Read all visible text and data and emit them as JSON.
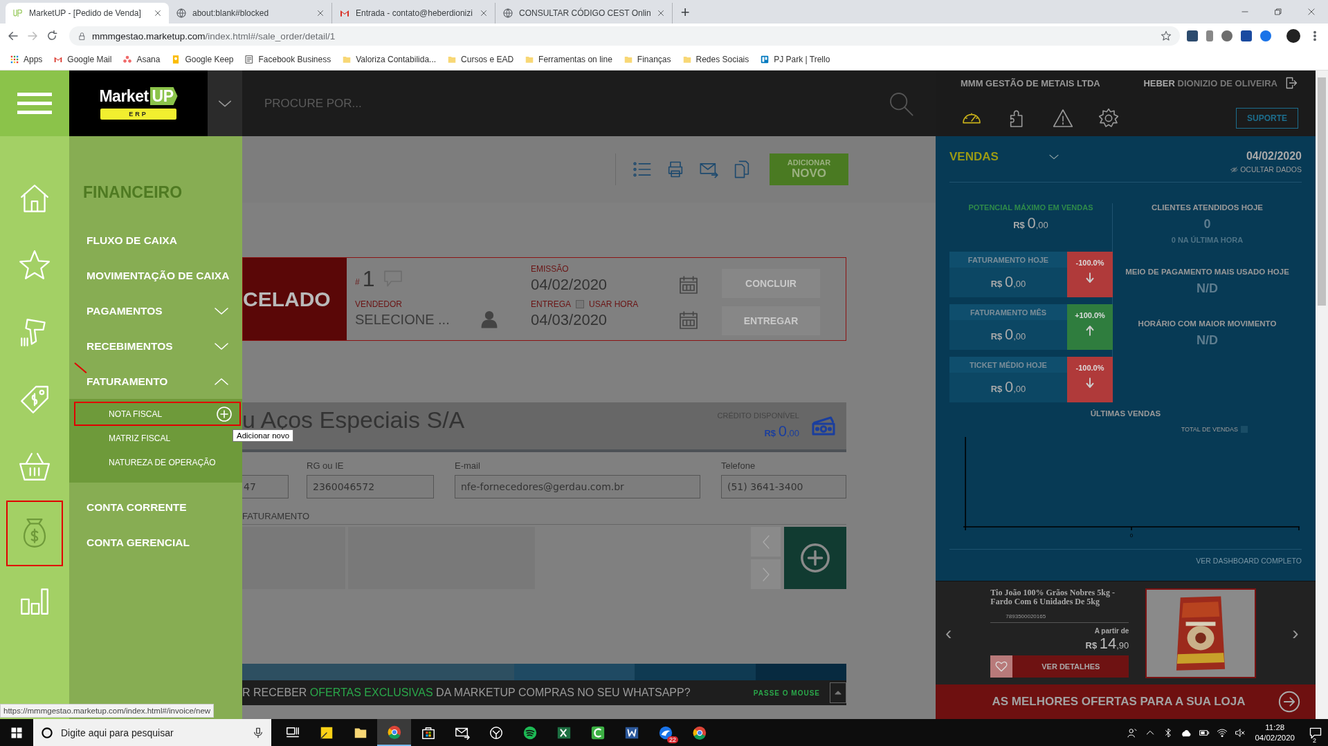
{
  "browser": {
    "tabs": [
      {
        "title": "MarketUP - [Pedido de Venda]",
        "selected": true
      },
      {
        "title": "about:blank#blocked",
        "selected": false
      },
      {
        "title": "Entrada - contato@heberdionizi",
        "selected": false
      },
      {
        "title": "CONSULTAR CÓDIGO CEST Onlin",
        "selected": false
      }
    ],
    "new_tab": "+",
    "address_host": "mmmgestao.marketup.com",
    "address_path": "/index.html#/sale_order/detail/1",
    "bookmarks": [
      "Apps",
      "Google Mail",
      "Asana",
      "Google Keep",
      "Facebook Business",
      "Valoriza Contabilida...",
      "Cursos e EAD",
      "Ferramentas on line",
      "Finanças",
      "Redes Sociais",
      "PJ Park | Trello"
    ],
    "status_url": "https://mmmgestao.marketup.com/index.html#/invoice/new"
  },
  "app": {
    "logo": "Market",
    "logo_accent": "UP",
    "logo_tag": "ERP",
    "search": {
      "placeholder": "PROCURE POR..."
    },
    "company": "MMM GESTÃO DE METAIS LTDA",
    "user_first": "HEBER",
    "user_rest": "DIONIZIO DE OLIVEIRA",
    "support": "SUPORTE",
    "header_icons": [
      {
        "kind": "gauge"
      },
      {
        "kind": "puzzle"
      },
      {
        "kind": "warning"
      },
      {
        "kind": "gear"
      }
    ]
  },
  "sidebar_icons": [
    {
      "kind": "home",
      "selected": false
    },
    {
      "kind": "star",
      "selected": false
    },
    {
      "kind": "scanner",
      "selected": false
    },
    {
      "kind": "tag",
      "selected": false
    },
    {
      "kind": "basket",
      "selected": false
    },
    {
      "kind": "money",
      "selected": true
    },
    {
      "kind": "bars",
      "selected": false
    }
  ],
  "menu": {
    "title": "FINANCEIRO",
    "items": [
      {
        "label": "FLUXO DE CAIXA",
        "expandable": false,
        "marked": false
      },
      {
        "label": "MOVIMENTAÇÃO DE CAIXA",
        "expandable": false,
        "marked": false
      },
      {
        "label": "PAGAMENTOS",
        "expandable": true,
        "expanded": false,
        "marked": false
      },
      {
        "label": "RECEBIMENTOS",
        "expandable": true,
        "expanded": false,
        "marked": false
      },
      {
        "label": "FATURAMENTO",
        "expandable": true,
        "expanded": true,
        "marked": true,
        "children": [
          {
            "label": "NOTA FISCAL",
            "highlighted": true,
            "tooltip": "Adicionar novo"
          },
          {
            "label": "MATRIZ FISCAL",
            "highlighted": false
          },
          {
            "label": "NATUREZA DE OPERAÇÃO",
            "highlighted": false
          }
        ]
      },
      {
        "label": "CONTA CORRENTE",
        "expandable": false,
        "marked": false
      },
      {
        "label": "CONTA GERENCIAL",
        "expandable": false,
        "marked": false
      }
    ]
  },
  "main": {
    "toolbar": [
      {
        "kind": "list"
      },
      {
        "kind": "print"
      },
      {
        "kind": "mail"
      },
      {
        "kind": "copy"
      }
    ],
    "add_button": {
      "top": "ADICIONAR",
      "bottom": "NOVO"
    },
    "order": {
      "status": "CELADO",
      "number_prefix": "#",
      "number": "1",
      "vendor_label": "VENDEDOR",
      "vendor": "SELECIONE ...",
      "issue_label": "EMISSÃO",
      "issue_date": "04/02/2020",
      "delivery_label": "ENTREGA",
      "use_time": {
        "label": "USAR HORA",
        "checked": false
      },
      "delivery_date": "04/03/2020",
      "actions": [
        {
          "label": "CONCLUIR",
          "disabled": true
        },
        {
          "label": "ENTREGAR",
          "disabled": true
        }
      ]
    },
    "customer": {
      "name": "u Aços Especiais S/A",
      "credit_label": "CRÉDITO DISPONÍVEL",
      "credit_currency": "R$",
      "credit_int": "0",
      "credit_dec": ",00"
    },
    "fields": [
      {
        "value": "47"
      },
      {
        "label": "RG ou IE",
        "value": "2360046572"
      },
      {
        "label": "E-mail",
        "value": "nfe-fornecedores@gerdau.com.br"
      },
      {
        "label": "Telefone",
        "value": "(51) 3641-3400"
      }
    ],
    "billing_label": "FATURAMENTO",
    "whatsapp": {
      "parts": [
        {
          "text": "R RECEBER ",
          "accent": false
        },
        {
          "text": "OFERTAS EXCLUSIVAS",
          "accent": true
        },
        {
          "text": " DA MARKETUP COMPRAS NO SEU WHATSAPP?",
          "accent": false
        }
      ],
      "hint": "PASSE O MOUSE"
    }
  },
  "dashboard": {
    "title": "VENDAS",
    "date": "04/02/2020",
    "hide": "OCULTAR DADOS",
    "potential_label": "POTENCIAL MÁXIMO EM VENDAS",
    "potential_currency": "R$",
    "potential_int": "0",
    "potential_dec": ",00",
    "metrics": [
      {
        "label": "FATURAMENTO HOJE",
        "currency": "R$",
        "int": "0",
        "dec": ",00",
        "change": "-100.0%",
        "rising": false
      },
      {
        "label": "FATURAMENTO MÊS",
        "currency": "R$",
        "int": "0",
        "dec": ",00",
        "change": "+100.0%",
        "rising": true
      },
      {
        "label": "TICKET MÉDIO HOJE",
        "currency": "R$",
        "int": "0",
        "dec": ",00",
        "change": "-100.0%",
        "rising": false
      }
    ],
    "stats": [
      {
        "label": "CLIENTES ATENDIDOS HOJE",
        "value": "0",
        "note": "0 NA ÚLTIMA HORA"
      },
      {
        "label": "MEIO DE PAGAMENTO MAIS USADO HOJE",
        "value": "N/D"
      },
      {
        "label": "HORÁRIO COM MAIOR MOVIMENTO",
        "value": "N/D"
      }
    ],
    "chart_title": "ÚLTIMAS VENDAS",
    "chart_legend": "TOTAL DE VENDAS",
    "chart_tick": "0",
    "dashboard_link": "VER DASHBOARD COMPLETO"
  },
  "offer": {
    "product": "Tio João 100% Grãos Nobres 5kg - Fardo Com 6 Unidades De 5kg",
    "code": "7893500020165",
    "from": "A partir de",
    "currency": "R$",
    "int": "14",
    "dec": ",90",
    "details": "VER DETALHES",
    "prev": "‹",
    "next": "›",
    "banner": "AS MELHORES OFERTAS PARA A SUA LOJA"
  },
  "taskbar": {
    "search_placeholder": "Digite aqui para pesquisar",
    "apps": [
      {
        "kind": "taskview",
        "active": false
      },
      {
        "kind": "notes",
        "active": false
      },
      {
        "kind": "folder",
        "active": false
      },
      {
        "kind": "chrome",
        "active": true
      },
      {
        "kind": "store",
        "active": false
      },
      {
        "kind": "mail",
        "active": false
      },
      {
        "kind": "game",
        "active": false
      },
      {
        "kind": "spotify",
        "active": false
      },
      {
        "kind": "excel",
        "active": false
      },
      {
        "kind": "camtasia",
        "active": false
      },
      {
        "kind": "word",
        "active": false
      },
      {
        "kind": "bird",
        "badge": "22",
        "active": false
      },
      {
        "kind": "chrome",
        "active": false
      }
    ],
    "time": "11:28",
    "date": "04/02/2020",
    "notifications": "2"
  }
}
